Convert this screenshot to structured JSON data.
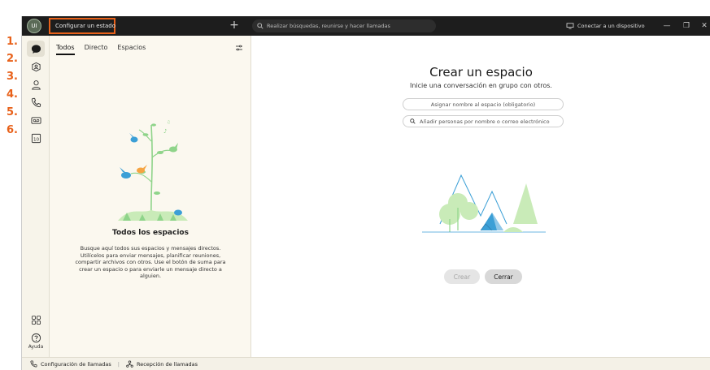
{
  "annotations": [
    "1.",
    "2.",
    "3.",
    "4.",
    "5.",
    "6."
  ],
  "titlebar": {
    "avatar_initials": "UI",
    "status_button": "Configurar un estado",
    "plus_symbol": "+",
    "search_placeholder": "Realizar búsquedas, reunirse y hacer llamadas",
    "connect_device": "Conectar a un dispositivo",
    "window_buttons": [
      "—",
      "❐",
      "✕"
    ]
  },
  "rail": {
    "items": [
      "messaging-icon",
      "teams-icon",
      "contacts-icon",
      "calls-icon",
      "voicemail-icon",
      "calendar-icon"
    ],
    "calendar_day": "10",
    "help_label": "Ayuda"
  },
  "list": {
    "tabs": [
      "Todos",
      "Directo",
      "Espacios"
    ],
    "active_tab": "Todos",
    "empty_title": "Todos los espacios",
    "empty_desc": "Busque aquí todos sus espacios y mensajes directos. Utilícelos para enviar mensajes, planificar reuniones, compartir archivos con otros. Use el botón de suma para crear un espacio o para enviarle un mensaje directo a alguien."
  },
  "main": {
    "title": "Crear un espacio",
    "subtitle": "Inicie una conversación en grupo con otros.",
    "name_placeholder": "Asignar nombre al espacio (obligatorio)",
    "people_placeholder": "Añadir personas por nombre o correo electrónico",
    "create_button": "Crear",
    "close_button": "Cerrar"
  },
  "bottombar": {
    "call_settings": "Configuración de llamadas",
    "separator": "|",
    "call_pickup": "Recepción de llamadas"
  },
  "colors": {
    "highlight": "#e8611a",
    "titlebar": "#1d1d1d",
    "panel": "#fbf8ef",
    "illustration_green": "#8fd48a",
    "illustration_blue": "#3b9fd6"
  }
}
